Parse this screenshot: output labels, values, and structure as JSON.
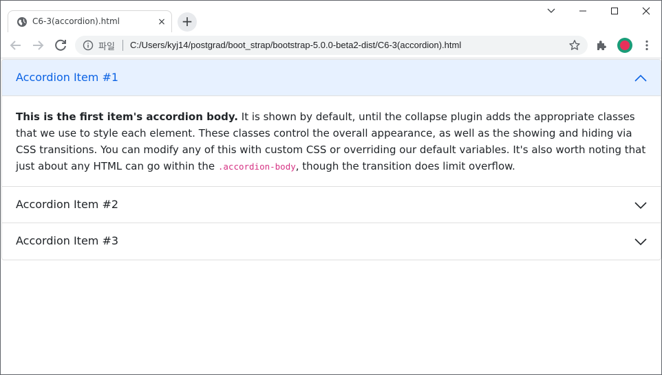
{
  "browser": {
    "tab": {
      "title": "C6-3(accordion).html",
      "close_glyph": "×",
      "favicon": "globe-icon"
    },
    "new_tab_glyph": "+",
    "omnibox": {
      "file_label": "파일",
      "url": "C:/Users/kyj14/postgrad/boot_strap/bootstrap-5.0.0-beta2-dist/C6-3(accordion).html"
    },
    "profile_colors": {
      "ring": "#1a9c78",
      "fill": "#e8315a"
    }
  },
  "accordion": {
    "items": [
      {
        "title": "Accordion Item #1",
        "expanded": true,
        "body": {
          "strong": "This is the first item's accordion body.",
          "text1": " It is shown by default, until the collapse plugin adds the appropriate classes that we use to style each element. These classes control the overall appearance, as well as the showing and hiding via CSS transitions. You can modify any of this with custom CSS or overriding our default variables. It's also worth noting that just about any HTML can go within the ",
          "code": ".accordion-body",
          "text2": ", though the transition does limit overflow."
        }
      },
      {
        "title": "Accordion Item #2",
        "expanded": false
      },
      {
        "title": "Accordion Item #3",
        "expanded": false
      }
    ],
    "colors": {
      "active_bg": "#e7f1ff",
      "active_text": "#0c63e4",
      "code": "#d63384"
    }
  }
}
